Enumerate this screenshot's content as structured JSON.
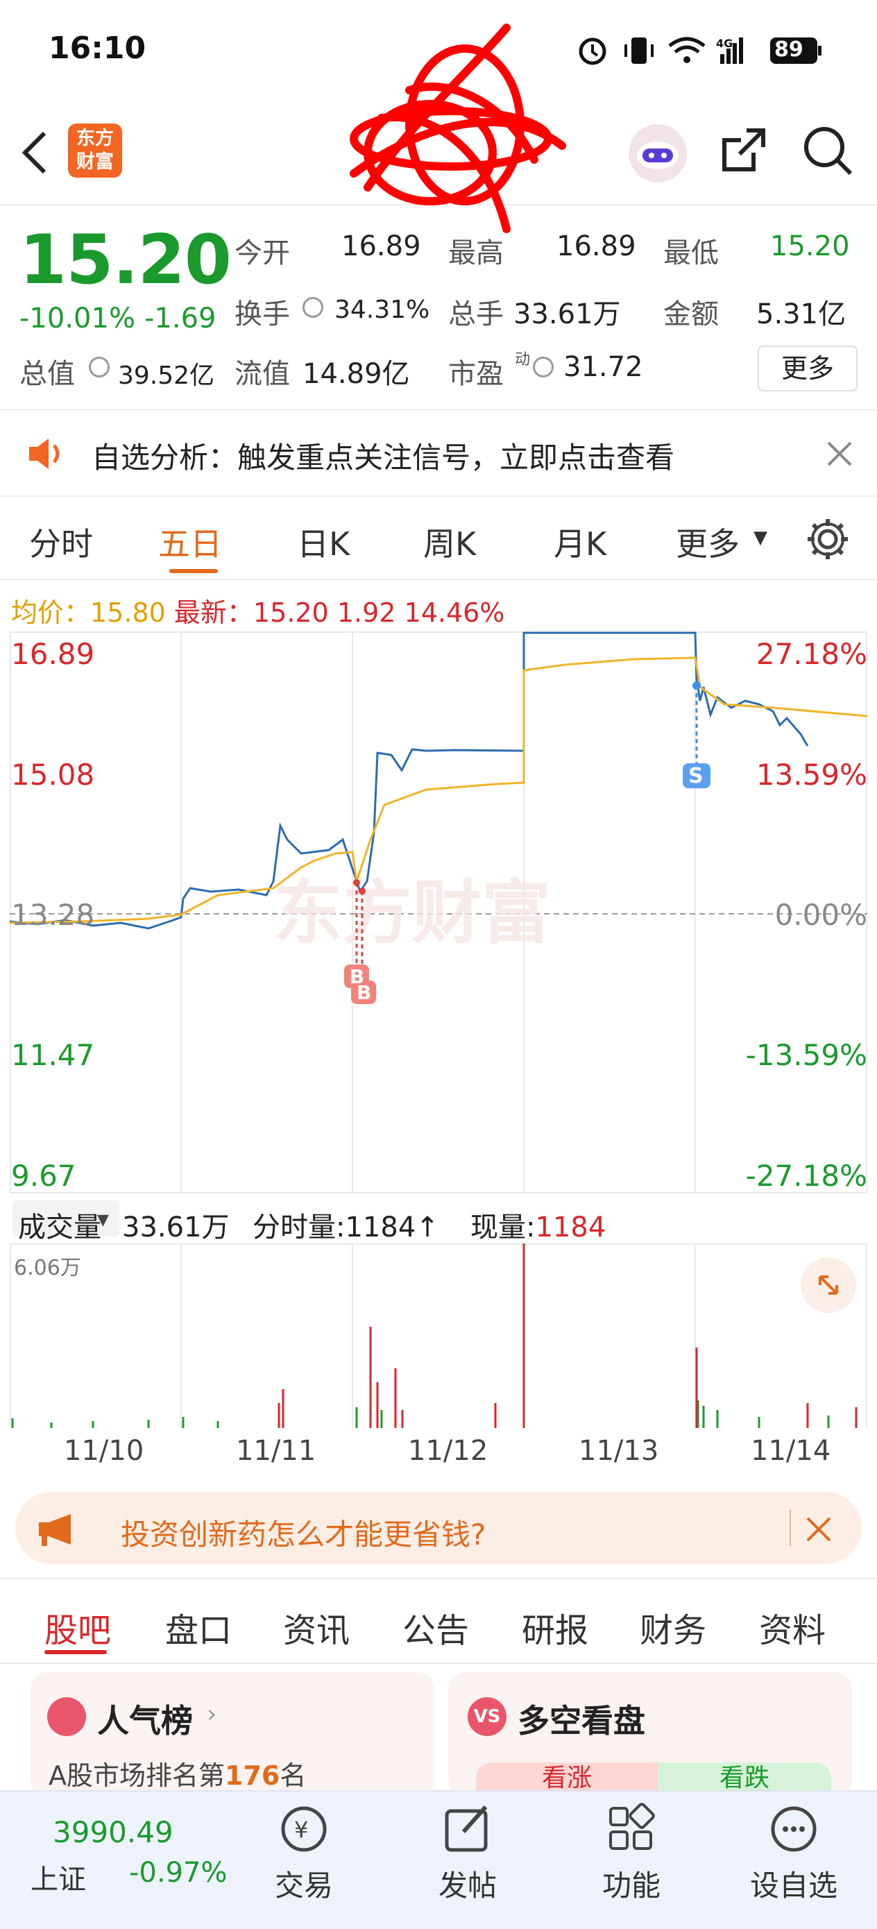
{
  "status": {
    "time": "16:10",
    "battery": "89",
    "network": "4G"
  },
  "header": {
    "logo_line1": "东方",
    "logo_line2": "财富"
  },
  "quote": {
    "price": "15.20",
    "change_pct": "-10.01%",
    "change_abs": "-1.69",
    "open_label": "今开",
    "open": "16.89",
    "high_label": "最高",
    "high": "16.89",
    "low_label": "最低",
    "low": "15.20",
    "turnover_label": "换手",
    "turnover": "34.31%",
    "volume_label": "总手",
    "volume": "33.61万",
    "amount_label": "金额",
    "amount": "5.31亿",
    "mcap_label": "总值",
    "mcap": "39.52亿",
    "float_label": "流值",
    "float": "14.89亿",
    "pe_label": "市盈",
    "pe_sup": "动",
    "pe": "31.72",
    "more": "更多"
  },
  "notice": {
    "text": "自选分析：触发重点关注信号，立即点击查看"
  },
  "tabs": [
    "分时",
    "五日",
    "日K",
    "周K",
    "月K",
    "更多"
  ],
  "active_tab": "五日",
  "infoline": {
    "avg_label": "均价：",
    "avg": "15.80",
    "latest_label": "最新：",
    "latest": "15.20",
    "chg": "1.92",
    "chg_pct": "14.46%"
  },
  "chart": {
    "left_labels": [
      "16.89",
      "15.08",
      "13.28",
      "11.47",
      "9.67"
    ],
    "right_labels": [
      "27.18%",
      "13.59%",
      "0.00%",
      "-13.59%",
      "-27.18%"
    ],
    "buy_mark": "B",
    "sell_mark": "S",
    "watermark": "东方财富"
  },
  "volume": {
    "label": "成交量",
    "total": "33.61万",
    "tick_label": "分时量:",
    "tick": "1184↑",
    "now_label": "现量:",
    "now": "1184",
    "max": "6.06万"
  },
  "dates": [
    "11/10",
    "11/11",
    "11/12",
    "11/13",
    "11/14"
  ],
  "ad": {
    "text": "投资创新药怎么才能更省钱?"
  },
  "bottom_tabs": [
    "股吧",
    "盘口",
    "资讯",
    "公告",
    "研报",
    "财务",
    "资料"
  ],
  "cards": {
    "left_title": "人气榜",
    "left_sub_prefix": "A股市场排名第",
    "left_rank": "176",
    "left_sub_suffix": "名",
    "right_title": "多空看盘",
    "up": "看涨",
    "down": "看跌"
  },
  "bottomnav": {
    "index_value": "3990.49",
    "index_name": "上证",
    "index_chg": "-0.97%",
    "trade": "交易",
    "post": "发帖",
    "func": "功能",
    "watch": "设自选"
  },
  "colors": {
    "accent": "#e26a1b",
    "up": "#d9262b",
    "down": "#1a9a2c",
    "line": "#2b6cb0",
    "avg": "#f0b429"
  },
  "icons": [
    "back-icon",
    "share-icon",
    "search-icon",
    "robot-icon",
    "speaker-icon",
    "close-icon",
    "settings-icon",
    "expand-icon",
    "megaphone-icon",
    "trade-icon",
    "post-icon",
    "grid-icon",
    "more-icon"
  ]
}
